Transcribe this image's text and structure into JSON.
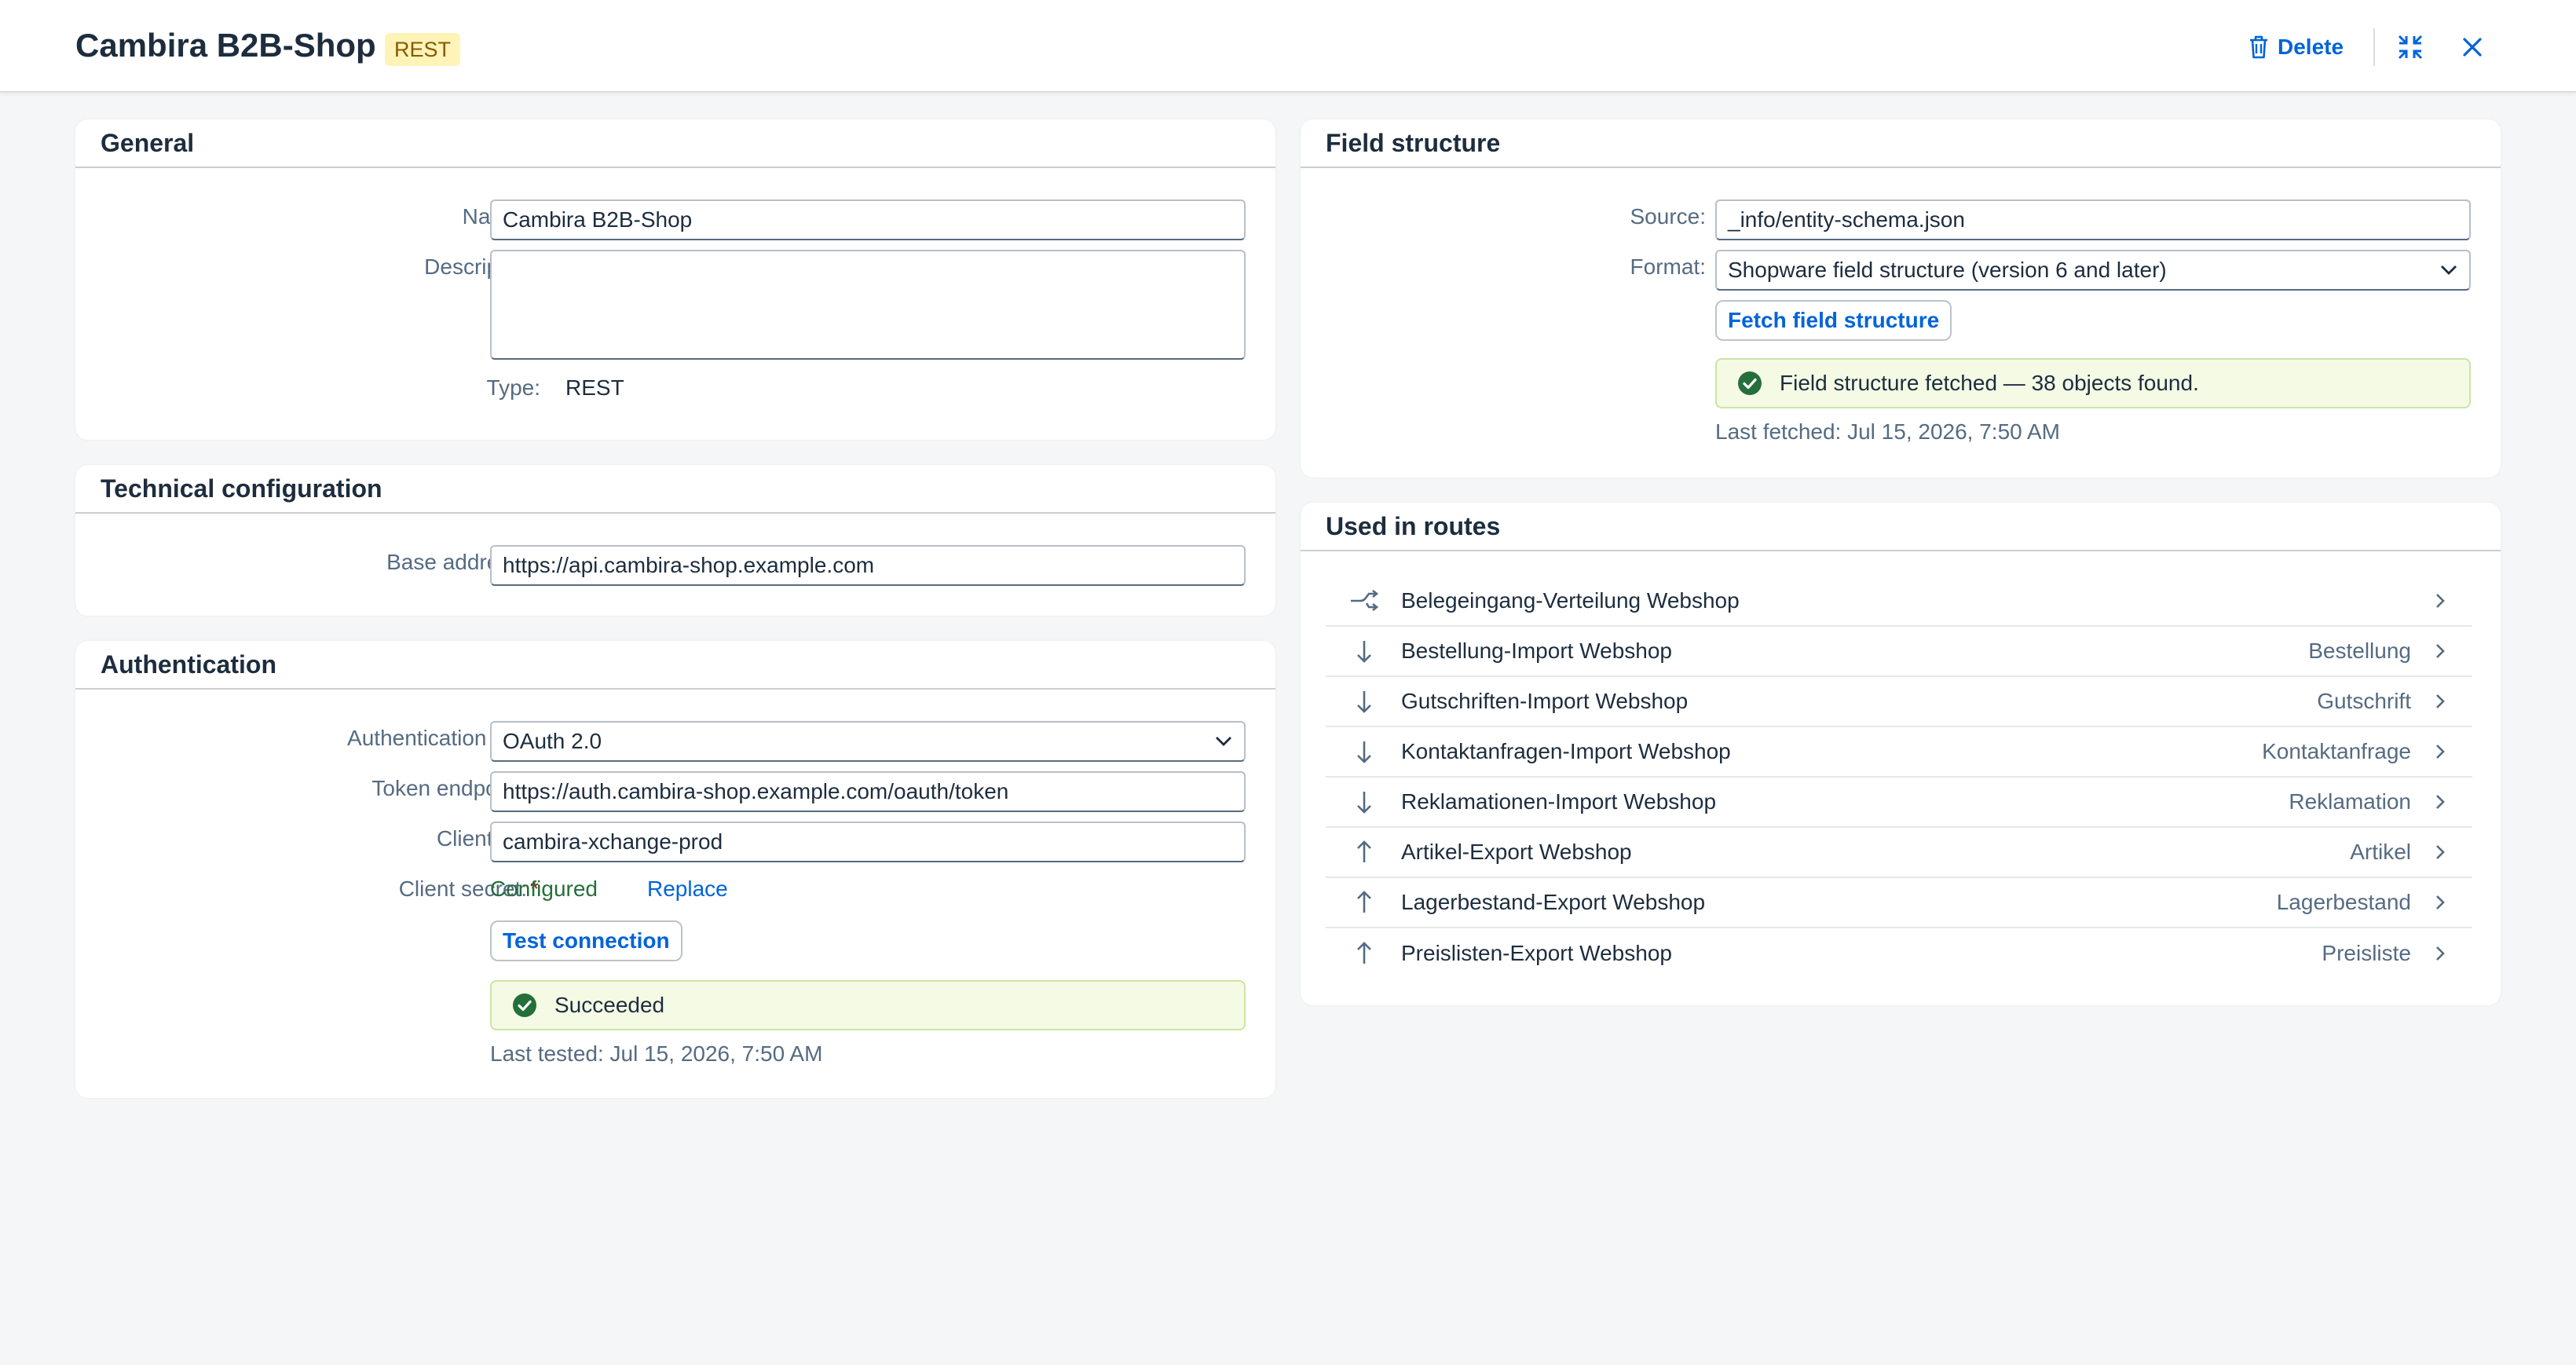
{
  "header": {
    "title": "Cambira B2B-Shop",
    "badge": "REST",
    "delete_label": "Delete",
    "icons": [
      "trash-icon",
      "collapse-icon",
      "close-icon"
    ]
  },
  "general": {
    "title": "General",
    "name_label": "Name:",
    "name_value": "Cambira B2B-Shop",
    "description_label": "Description:",
    "description_value": "",
    "type_label": "Type:",
    "type_value": "REST"
  },
  "technical": {
    "title": "Technical configuration",
    "base_label": "Base address:",
    "base_value": "https://api.cambira-shop.example.com"
  },
  "auth": {
    "title": "Authentication",
    "type_label": "Authentication type:",
    "type_value": "OAuth 2.0",
    "token_label": "Token endpoint:",
    "token_value": "https://auth.cambira-shop.example.com/oauth/token",
    "client_id_label": "Client ID:",
    "client_id_value": "cambira-xchange-prod",
    "secret_label": "Client secret:",
    "secret_status": "Configured",
    "secret_replace": "Replace",
    "test_button": "Test connection",
    "result": "Succeeded",
    "last_tested": "Last tested: Jul 15, 2026, 7:50 AM"
  },
  "field_structure": {
    "title": "Field structure",
    "source_label": "Source:",
    "source_value": "_info/entity-schema.json",
    "format_label": "Format:",
    "format_value": "Shopware field structure (version 6 and later)",
    "fetch_button": "Fetch field structure",
    "result": "Field structure fetched — 38 objects found.",
    "last_fetched": "Last fetched: Jul 15, 2026, 7:50 AM"
  },
  "routes": {
    "title": "Used in routes",
    "items": [
      {
        "name": "Belegeingang-Verteilung Webshop",
        "object": "",
        "icon": "distribute-icon"
      },
      {
        "name": "Bestellung-Import Webshop",
        "object": "Bestellung",
        "icon": "arrow-down-icon"
      },
      {
        "name": "Gutschriften-Import Webshop",
        "object": "Gutschrift",
        "icon": "arrow-down-icon"
      },
      {
        "name": "Kontaktanfragen-Import Webshop",
        "object": "Kontaktanfrage",
        "icon": "arrow-down-icon"
      },
      {
        "name": "Reklamationen-Import Webshop",
        "object": "Reklamation",
        "icon": "arrow-down-icon"
      },
      {
        "name": "Artikel-Export Webshop",
        "object": "Artikel",
        "icon": "arrow-up-icon"
      },
      {
        "name": "Lagerbestand-Export Webshop",
        "object": "Lagerbestand",
        "icon": "arrow-up-icon"
      },
      {
        "name": "Preislisten-Export Webshop",
        "object": "Preisliste",
        "icon": "arrow-up-icon"
      }
    ]
  },
  "colors": {
    "accent": "#0064d9",
    "success": "#256f3a",
    "required": "#aa0808",
    "badge_bg": "#fff3b8"
  }
}
